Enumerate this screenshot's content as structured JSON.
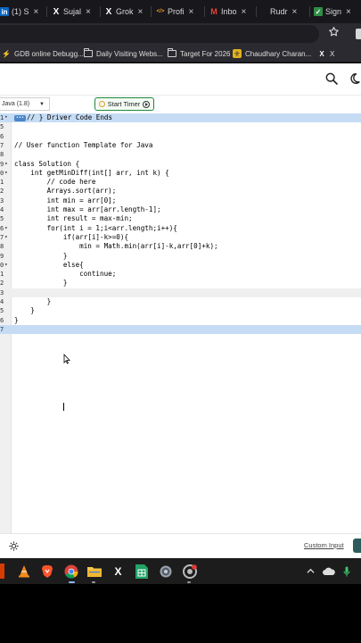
{
  "tabs": [
    {
      "label": "(1) S",
      "icon_text": "in",
      "icon_color": "#0a66c2"
    },
    {
      "label": "Sujal",
      "icon_text": "X",
      "icon_color": "#ffffff"
    },
    {
      "label": "Grok",
      "icon_text": "X",
      "icon_color": "#ffffff"
    },
    {
      "label": "Profi",
      "icon_text": "</>",
      "icon_color": "#f0a028"
    },
    {
      "label": "Inbo",
      "icon_text": "M",
      "icon_color": "#ea4335"
    },
    {
      "label": "Rudr",
      "icon_text": "",
      "icon_color": "#18171c"
    },
    {
      "label": "Sign",
      "icon_text": "✓",
      "icon_color": "#2f8d46"
    }
  ],
  "tab_close_glyph": "×",
  "star_icon": "star-icon",
  "bookmarks": [
    {
      "label": "GDB online Debugg...",
      "icon": "gdb-icon"
    },
    {
      "label": "Daily Visiting Webs...",
      "icon": "folder-icon"
    },
    {
      "label": "Target For 2026",
      "icon": "folder-icon"
    },
    {
      "label": "Chaudhary Charan...",
      "icon": "ccs-icon"
    },
    {
      "label": "X",
      "icon": "x-icon"
    }
  ],
  "editor": {
    "language": "Java (1.8)",
    "start_timer": "Start Timer",
    "custom_input": "Custom Input",
    "code_lines": [
      {
        "ln": "1",
        "fold": "•",
        "text": "// } Driver Code Ends",
        "hl": "blue",
        "cls": "c-comment",
        "bubble": "•••"
      },
      {
        "ln": "5",
        "fold": "",
        "text": "",
        "hl": ""
      },
      {
        "ln": "6",
        "fold": "",
        "text": "",
        "hl": ""
      },
      {
        "ln": "7",
        "fold": "",
        "text": "// User function Template for Java",
        "hl": "",
        "cls": "c-comment"
      },
      {
        "ln": "8",
        "fold": "",
        "text": "",
        "hl": ""
      },
      {
        "ln": "9",
        "fold": "▾",
        "text": "class Solution {",
        "hl": ""
      },
      {
        "ln": "0",
        "fold": "▾",
        "text": "    int getMinDiff(int[] arr, int k) {",
        "hl": ""
      },
      {
        "ln": "1",
        "fold": "",
        "text": "        // code here",
        "hl": "",
        "cls": "c-comment"
      },
      {
        "ln": "2",
        "fold": "",
        "text": "        Arrays.sort(arr);",
        "hl": ""
      },
      {
        "ln": "3",
        "fold": "",
        "text": "        int min = arr[0];",
        "hl": ""
      },
      {
        "ln": "4",
        "fold": "",
        "text": "        int max = arr[arr.length-1];",
        "hl": ""
      },
      {
        "ln": "5",
        "fold": "",
        "text": "        int result = max-min;",
        "hl": ""
      },
      {
        "ln": "6",
        "fold": "▾",
        "text": "        for(int i = 1;i<arr.length;i++){",
        "hl": ""
      },
      {
        "ln": "7",
        "fold": "▾",
        "text": "            if(arr[i]-k>=0){",
        "hl": ""
      },
      {
        "ln": "8",
        "fold": "",
        "text": "                min = Math.min(arr[i]-k,arr[0]+k);",
        "hl": ""
      },
      {
        "ln": "9",
        "fold": "",
        "text": "            }",
        "hl": ""
      },
      {
        "ln": "0",
        "fold": "▾",
        "text": "            else{",
        "hl": ""
      },
      {
        "ln": "1",
        "fold": "",
        "text": "                continue;",
        "hl": ""
      },
      {
        "ln": "2",
        "fold": "",
        "text": "            }",
        "hl": ""
      },
      {
        "ln": "3",
        "fold": "",
        "text": "            ",
        "hl": "gray"
      },
      {
        "ln": "4",
        "fold": "",
        "text": "        }",
        "hl": ""
      },
      {
        "ln": "5",
        "fold": "",
        "text": "    }",
        "hl": ""
      },
      {
        "ln": "6",
        "fold": "",
        "text": "}",
        "hl": ""
      },
      {
        "ln": "7",
        "fold": "",
        "text": "",
        "hl": "blue"
      }
    ]
  },
  "taskbar": {
    "apps": [
      "office-icon",
      "vlc-icon",
      "brave-icon",
      "chrome-icon",
      "files-icon",
      "x-icon",
      "sheets-icon",
      "settings-icon",
      "chrome-beta-icon"
    ],
    "tray": [
      "chevron-up-icon",
      "cloud-icon",
      "mic-icon"
    ]
  },
  "colors": {
    "tab_bg": "#18171c",
    "toolbar_bg": "#2b2a30",
    "highlight_blue": "#c6dcf5",
    "timer_border": "#1e8a3c",
    "submit": "#2d5a5a"
  }
}
